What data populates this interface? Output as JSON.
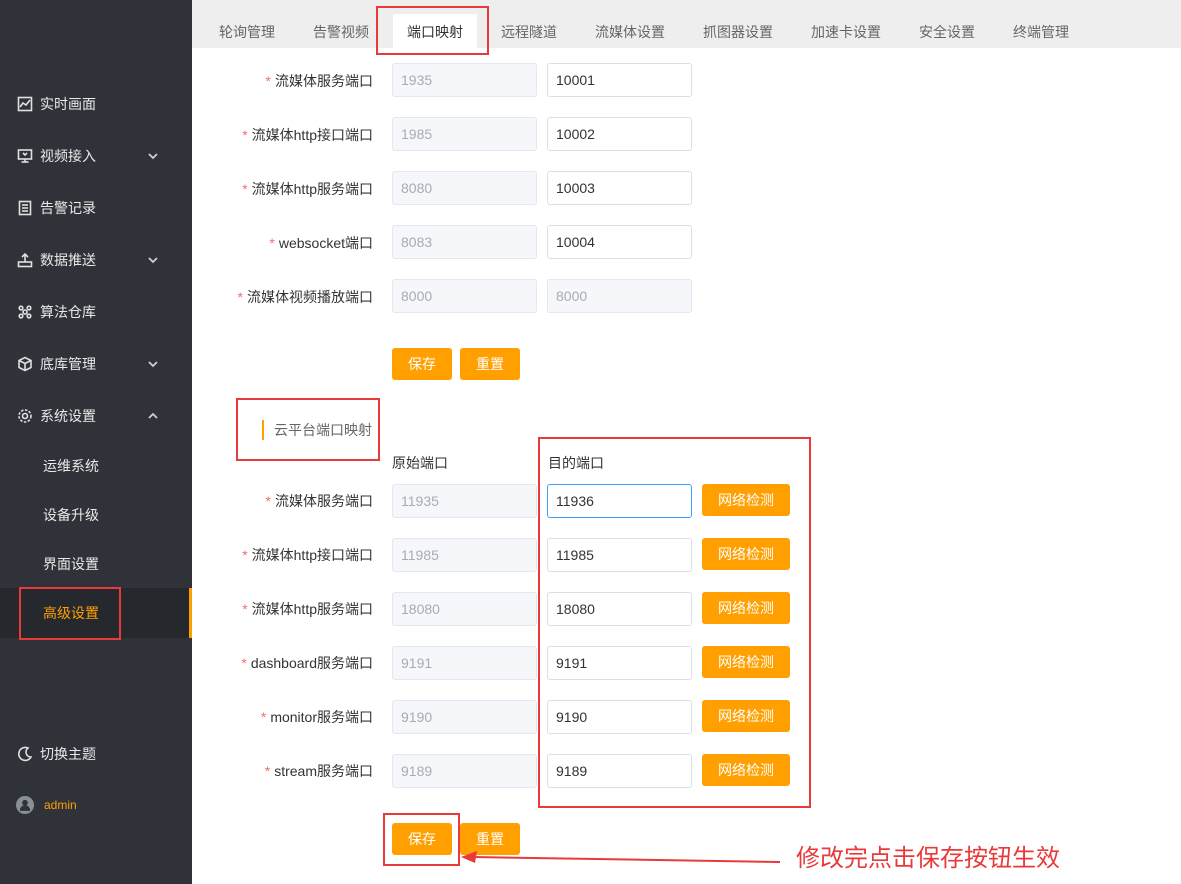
{
  "sidebar": {
    "items": [
      {
        "label": "实时画面",
        "icon": "line-chart-icon"
      },
      {
        "label": "视频接入",
        "icon": "monitor-icon"
      },
      {
        "label": "告警记录",
        "icon": "document-icon"
      },
      {
        "label": "数据推送",
        "icon": "upload-icon"
      },
      {
        "label": "算法仓库",
        "icon": "cluster-icon"
      },
      {
        "label": "底库管理",
        "icon": "cube-icon"
      },
      {
        "label": "系统设置",
        "icon": "gear-icon"
      }
    ],
    "sub_items": [
      {
        "label": "运维系统"
      },
      {
        "label": "设备升级"
      },
      {
        "label": "界面设置"
      },
      {
        "label": "高级设置"
      }
    ],
    "theme_label": "切换主题",
    "user_label": "admin"
  },
  "tabs": [
    "轮询管理",
    "告警视频",
    "端口映射",
    "远程隧道",
    "流媒体设置",
    "抓图器设置",
    "加速卡设置",
    "安全设置",
    "终端管理"
  ],
  "form1": {
    "rows": [
      {
        "label": "流媒体服务端口",
        "orig": "1935",
        "target": "10001"
      },
      {
        "label": "流媒体http接口端口",
        "orig": "1985",
        "target": "10002"
      },
      {
        "label": "流媒体http服务端口",
        "orig": "8080",
        "target": "10003"
      },
      {
        "label": "websocket端口",
        "orig": "8083",
        "target": "10004"
      },
      {
        "label": "流媒体视频播放端口",
        "orig": "8000",
        "target": "8000"
      }
    ],
    "save_label": "保存",
    "reset_label": "重置"
  },
  "form2": {
    "section_title": "云平台端口映射",
    "col_orig": "原始端口",
    "col_target": "目的端口",
    "check_label": "网络检测",
    "rows": [
      {
        "label": "流媒体服务端口",
        "orig": "11935",
        "target": "11936"
      },
      {
        "label": "流媒体http接口端口",
        "orig": "11985",
        "target": "11985"
      },
      {
        "label": "流媒体http服务端口",
        "orig": "18080",
        "target": "18080"
      },
      {
        "label": "dashboard服务端口",
        "orig": "9191",
        "target": "9191"
      },
      {
        "label": "monitor服务端口",
        "orig": "9190",
        "target": "9190"
      },
      {
        "label": "stream服务端口",
        "orig": "9189",
        "target": "9189"
      }
    ],
    "save_label": "保存",
    "reset_label": "重置"
  },
  "annotation": "修改完点击保存按钮生效",
  "colors": {
    "accent": "#ff9f00",
    "sidebar_bg": "#2f3339",
    "highlight": "#e83a3a"
  }
}
